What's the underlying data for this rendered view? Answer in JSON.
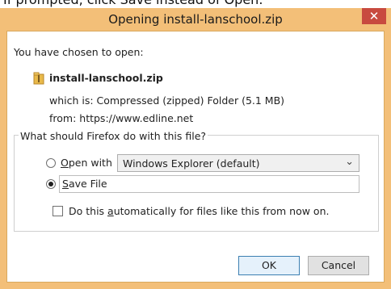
{
  "caption": "If prompted, click Save instead of Open.",
  "dialog": {
    "title": "Opening install-lanschool.zip",
    "close_glyph": "✕",
    "intro": "You have chosen to open:",
    "file_name": "install-lanschool.zip",
    "which_is": "which is: Compressed (zipped) Folder (5.1 MB)",
    "from": "from: https://www.edline.net",
    "question": "What should Firefox do with this file?",
    "open_with_label": {
      "underlined": "O",
      "rest": "pen with"
    },
    "open_with_value": "Windows Explorer (default)",
    "save_file_label": {
      "underlined": "S",
      "rest": "ave File"
    },
    "auto_label": {
      "before": "Do this ",
      "underlined": "a",
      "after": "utomatically for files like this from now on."
    },
    "ok_label": "OK",
    "cancel_label": "Cancel",
    "selected_option": "save-file",
    "auto_checked": false
  },
  "colors": {
    "frame": "#f3bf78",
    "close_button": "#c84a3f"
  }
}
